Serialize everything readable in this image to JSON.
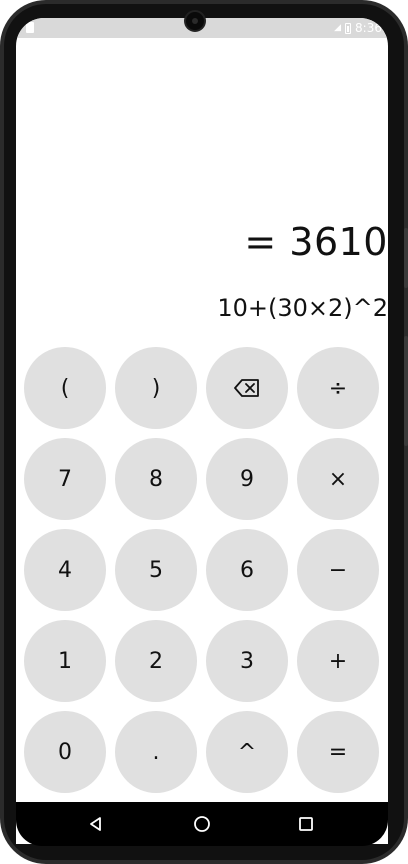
{
  "status": {
    "time": "8:36"
  },
  "display": {
    "result": "= 3610",
    "expression": "10+(30×2)^2"
  },
  "keys": [
    {
      "id": "open-paren-key",
      "label": "("
    },
    {
      "id": "close-paren-key",
      "label": ")"
    },
    {
      "id": "backspace-key",
      "label": "",
      "icon": "backspace-icon"
    },
    {
      "id": "divide-key",
      "label": "÷"
    },
    {
      "id": "digit-7-key",
      "label": "7"
    },
    {
      "id": "digit-8-key",
      "label": "8"
    },
    {
      "id": "digit-9-key",
      "label": "9"
    },
    {
      "id": "multiply-key",
      "label": "×"
    },
    {
      "id": "digit-4-key",
      "label": "4"
    },
    {
      "id": "digit-5-key",
      "label": "5"
    },
    {
      "id": "digit-6-key",
      "label": "6"
    },
    {
      "id": "minus-key",
      "label": "−"
    },
    {
      "id": "digit-1-key",
      "label": "1"
    },
    {
      "id": "digit-2-key",
      "label": "2"
    },
    {
      "id": "digit-3-key",
      "label": "3"
    },
    {
      "id": "plus-key",
      "label": "+"
    },
    {
      "id": "digit-0-key",
      "label": "0"
    },
    {
      "id": "decimal-key",
      "label": "."
    },
    {
      "id": "power-key",
      "label": "^"
    },
    {
      "id": "equals-key",
      "label": "="
    }
  ],
  "colors": {
    "key_background": "#e0e0e0",
    "status_bar": "#d9d9d9",
    "nav_bar": "#000000"
  }
}
